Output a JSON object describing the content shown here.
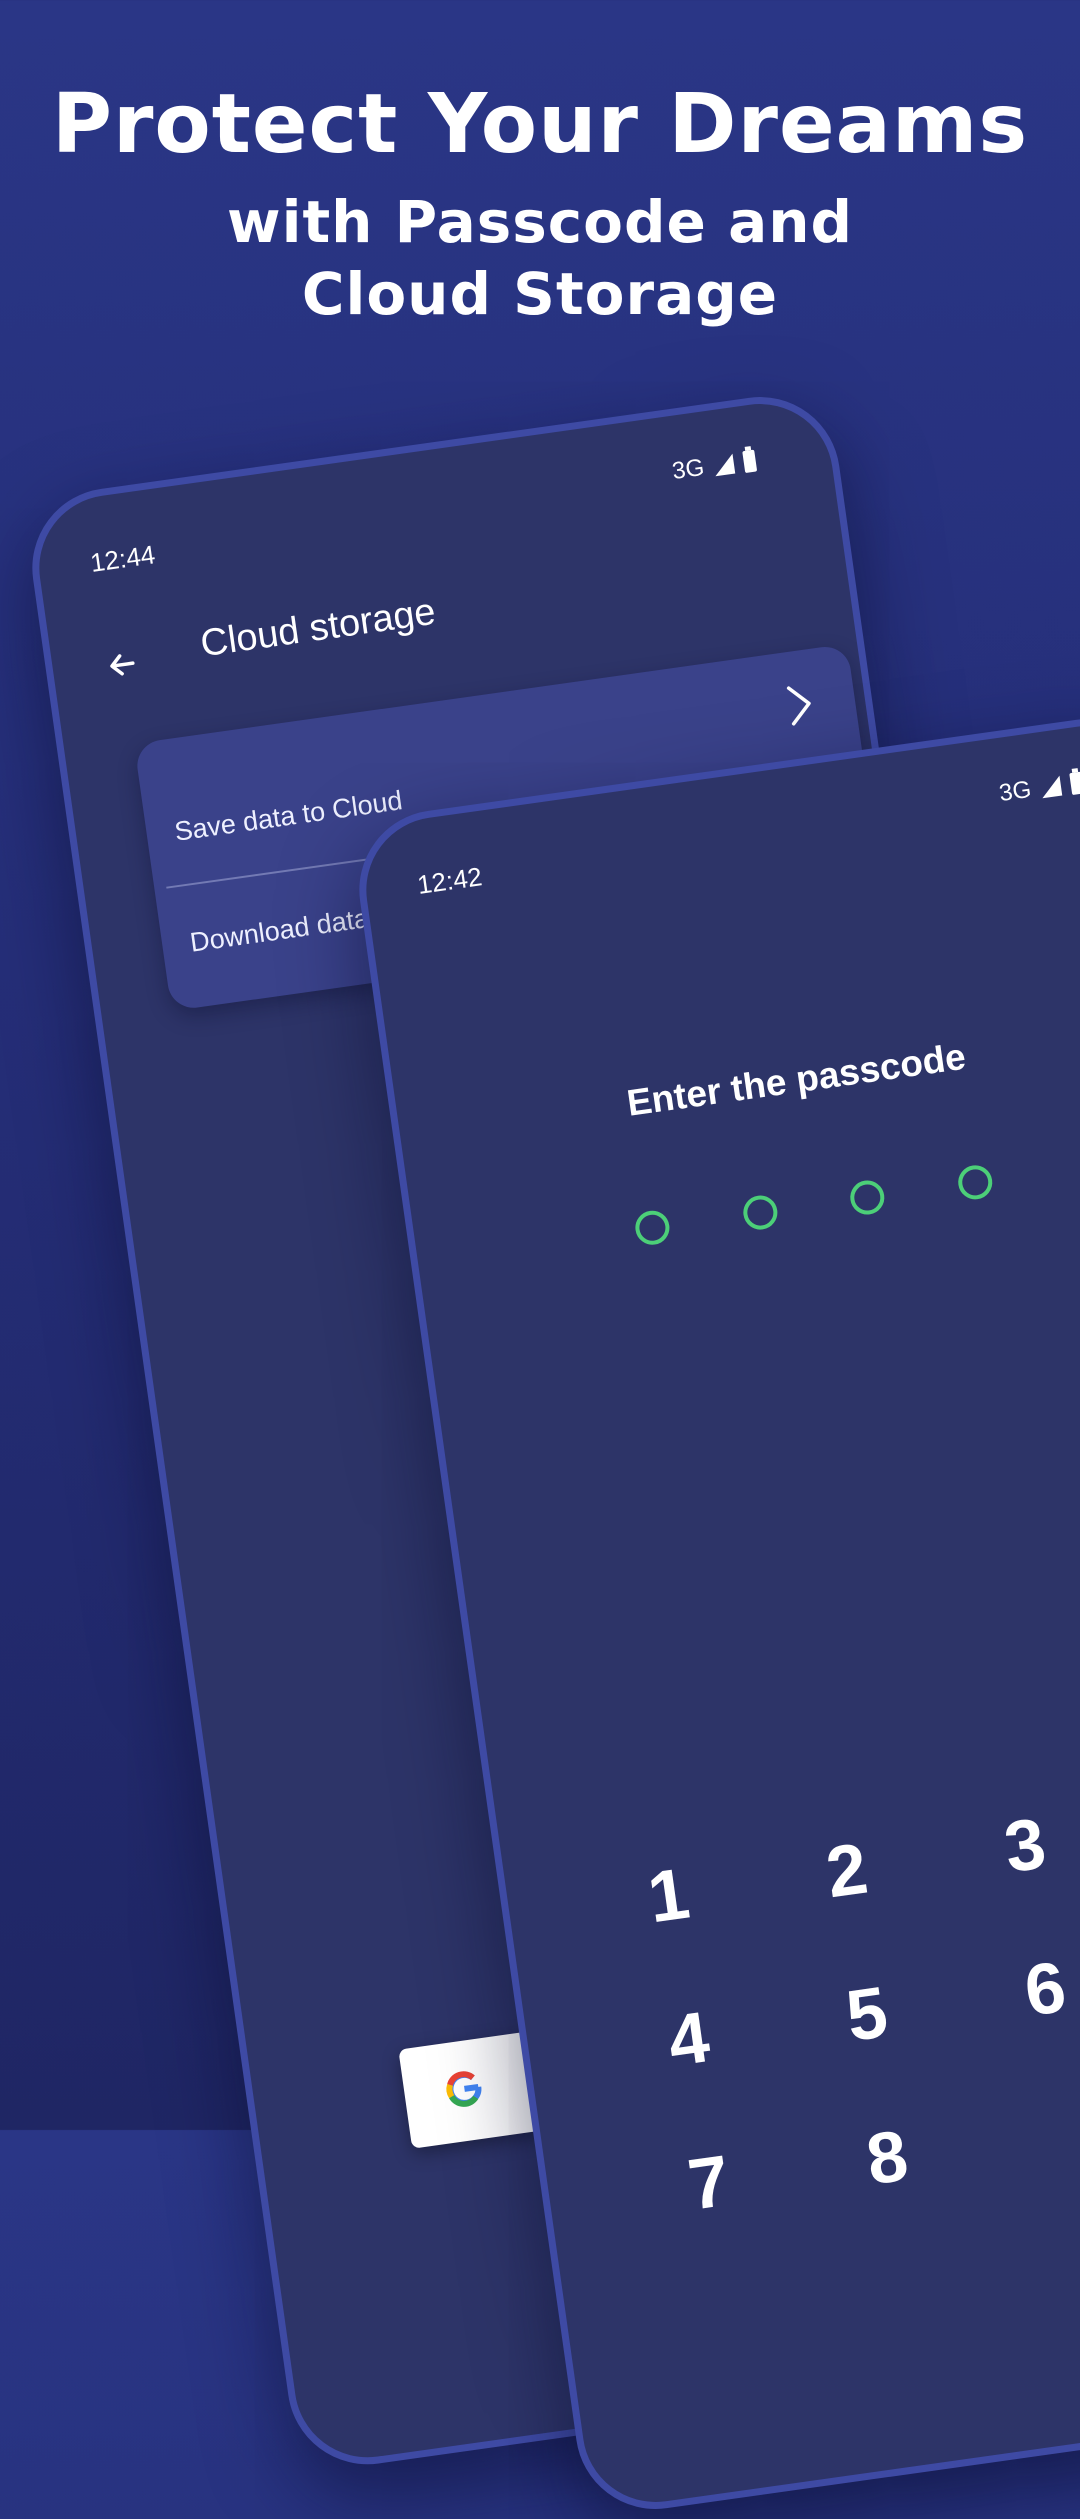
{
  "headline": {
    "line1": "Protect Your Dreams",
    "line2": "with Passcode and",
    "line3": "Cloud Storage"
  },
  "cloud_phone": {
    "time": "12:44",
    "network": "3G",
    "title": "Cloud storage",
    "rows": [
      {
        "label": "Save data to Cloud"
      },
      {
        "label": "Download data"
      }
    ]
  },
  "passcode_phone": {
    "time": "12:42",
    "network": "3G",
    "title": "Enter the passcode",
    "keys": [
      "1",
      "2",
      "3",
      "4",
      "5",
      "6",
      "7",
      "8"
    ]
  },
  "colors": {
    "background": "#27307a",
    "phone_frame": "#3e4aa4",
    "screen": "#2d3468",
    "card": "#3a428a",
    "dot_accent": "#4ccf78"
  }
}
